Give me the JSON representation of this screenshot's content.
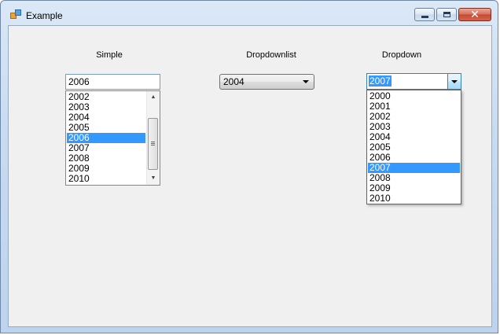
{
  "window": {
    "title": "Example"
  },
  "labels": {
    "simple": "Simple",
    "dropdownlist": "Dropdownlist",
    "dropdown": "Dropdown"
  },
  "simple": {
    "value": "2006",
    "items": [
      "2002",
      "2003",
      "2004",
      "2005",
      "2006",
      "2007",
      "2008",
      "2009",
      "2010"
    ],
    "selected_index": 4
  },
  "dropdownlist": {
    "value": "2004"
  },
  "dropdown": {
    "value": "2007",
    "items": [
      "2000",
      "2001",
      "2002",
      "2003",
      "2004",
      "2005",
      "2006",
      "2007",
      "2008",
      "2009",
      "2010"
    ],
    "selected_index": 7
  },
  "icons": {
    "app": "window-app-icon",
    "minimize": "minimize-icon",
    "maximize": "maximize-icon",
    "close": "close-icon"
  },
  "colors": {
    "selection": "#3399ff",
    "client_bg": "#f0f0f0"
  }
}
